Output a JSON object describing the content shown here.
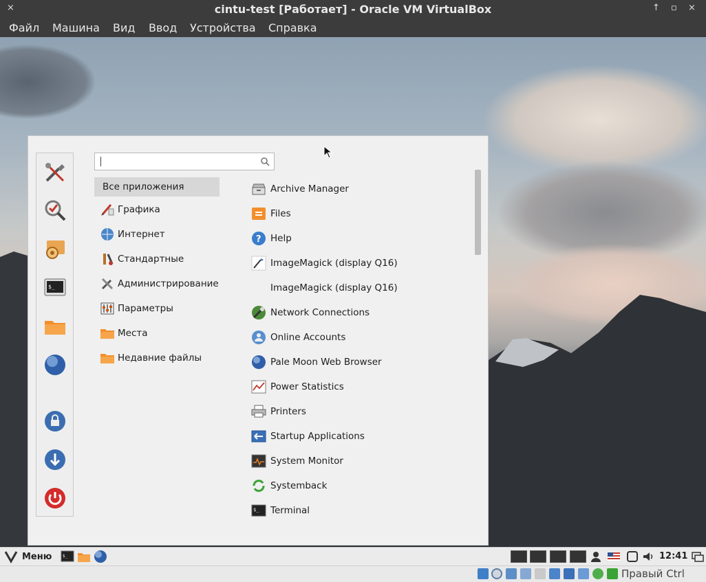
{
  "window": {
    "title": "cintu-test [Работает] - Oracle VM VirtualBox",
    "close_glyph": "×",
    "up_glyph": "↑",
    "min_glyph": "▫",
    "max_glyph": "×"
  },
  "menubar": {
    "items": [
      "Файл",
      "Машина",
      "Вид",
      "Ввод",
      "Устройства",
      "Справка"
    ]
  },
  "app_menu": {
    "search_value": "",
    "favorites": [
      "tools-icon",
      "search-check-icon",
      "settings-icon",
      "terminal-icon",
      "folder-icon",
      "globe-icon",
      "lock-icon",
      "logout-icon",
      "power-icon"
    ],
    "categories": [
      {
        "label": "Все приложения",
        "icon": "none",
        "selected": true
      },
      {
        "label": "Графика",
        "icon": "graphics-icon"
      },
      {
        "label": "Интернет",
        "icon": "internet-icon"
      },
      {
        "label": "Стандартные",
        "icon": "accessories-icon"
      },
      {
        "label": "Администрирование",
        "icon": "admin-icon"
      },
      {
        "label": "Параметры",
        "icon": "preferences-icon"
      },
      {
        "label": "Места",
        "icon": "places-icon"
      },
      {
        "label": "Недавние файлы",
        "icon": "recent-icon"
      }
    ],
    "apps": [
      {
        "label": "Archive Manager",
        "icon": "archive-icon"
      },
      {
        "label": "Files",
        "icon": "files-icon"
      },
      {
        "label": "Help",
        "icon": "help-icon"
      },
      {
        "label": "ImageMagick (display Q16)",
        "icon": "imagemagick-icon"
      },
      {
        "label": "ImageMagick (display Q16)",
        "icon": "none"
      },
      {
        "label": "Network Connections",
        "icon": "network-icon"
      },
      {
        "label": "Online Accounts",
        "icon": "online-accounts-icon"
      },
      {
        "label": "Pale Moon Web Browser",
        "icon": "palemoon-icon"
      },
      {
        "label": "Power Statistics",
        "icon": "power-stats-icon"
      },
      {
        "label": "Printers",
        "icon": "printer-icon"
      },
      {
        "label": "Startup Applications",
        "icon": "startup-icon"
      },
      {
        "label": "System Monitor",
        "icon": "system-monitor-icon"
      },
      {
        "label": "Systemback",
        "icon": "systemback-icon"
      },
      {
        "label": "Terminal",
        "icon": "terminal-icon"
      }
    ]
  },
  "panel": {
    "menu_label": "Меню",
    "clock": "12:41"
  },
  "statusbar": {
    "host_key": "Правый Ctrl"
  },
  "colors": {
    "titlebar": "#3c3c3c",
    "menu_bg": "#f0f0f0",
    "selected_category": "#d7d7d7",
    "folder_orange": "#f28f2d"
  }
}
